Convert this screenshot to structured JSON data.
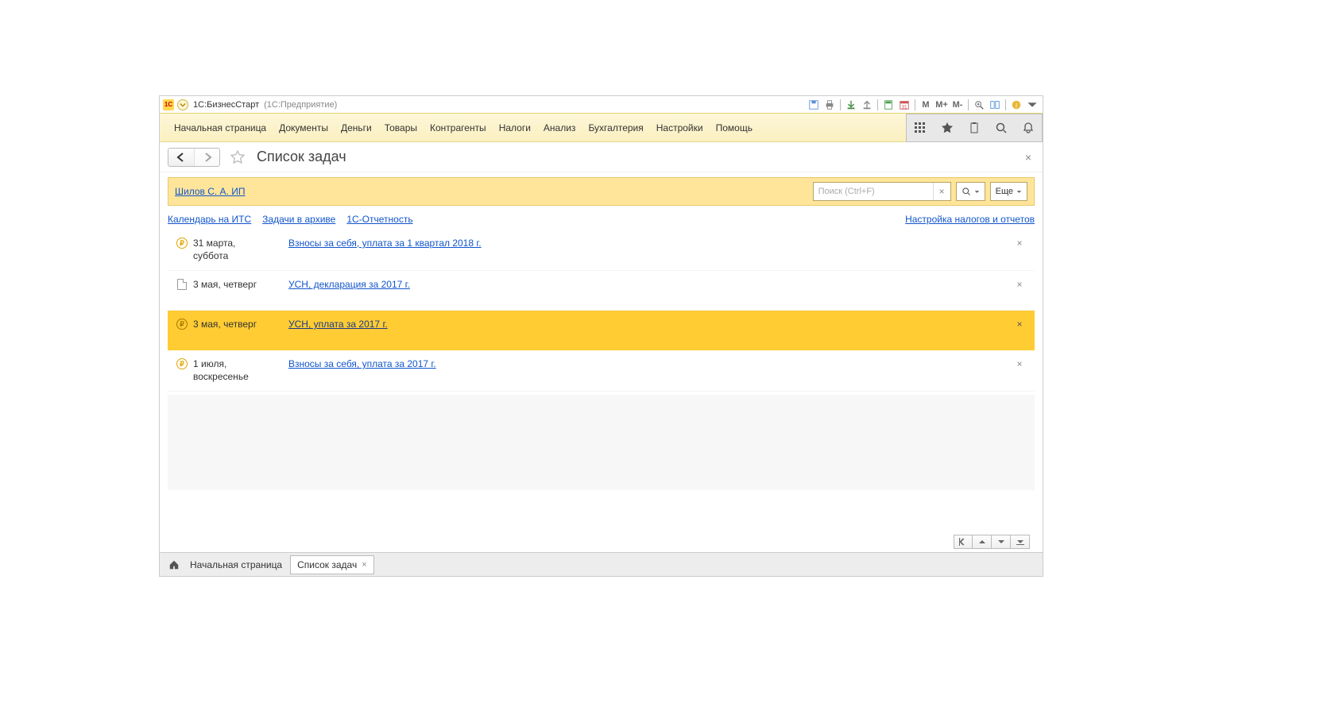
{
  "title": {
    "app_name": "1С:БизнесСтарт",
    "platform": "(1С:Предприятие)"
  },
  "titlebar_icons": [
    "save",
    "print",
    "download",
    "upload",
    "calendar",
    "date31",
    "M",
    "M+",
    "M-",
    "zoom",
    "panes",
    "info"
  ],
  "menu": [
    "Начальная страница",
    "Документы",
    "Деньги",
    "Товары",
    "Контрагенты",
    "Налоги",
    "Анализ",
    "Бухгалтерия",
    "Настройки",
    "Помощь"
  ],
  "page": {
    "title": "Список задач"
  },
  "org": {
    "name": "Шилов С. А. ИП"
  },
  "search": {
    "placeholder": "Поиск (Ctrl+F)"
  },
  "more_button": "Еще",
  "links": {
    "calendar_its": "Календарь на ИТС",
    "archive": "Задачи в архиве",
    "reporting": "1С-Отчетность",
    "tax_settings": "Настройка налогов и отчетов"
  },
  "tasks": [
    {
      "icon": "ruble",
      "date_line1": "31 марта,",
      "date_line2": "суббота",
      "title": "Взносы за себя, уплата за 1 квартал 2018 г.",
      "selected": false
    },
    {
      "icon": "doc",
      "date_line1": "3 мая, четверг",
      "date_line2": "",
      "title": "УСН, декларация за 2017 г.",
      "selected": false
    },
    {
      "icon": "ruble",
      "date_line1": "3 мая, четверг",
      "date_line2": "",
      "title": "УСН, уплата за 2017 г.",
      "selected": true
    },
    {
      "icon": "ruble",
      "date_line1": "1 июля,",
      "date_line2": "воскресенье",
      "title": "Взносы за себя, уплата за 2017 г.",
      "selected": false
    }
  ],
  "tabs": {
    "home_label": "Начальная страница",
    "active_tab": "Список задач"
  }
}
